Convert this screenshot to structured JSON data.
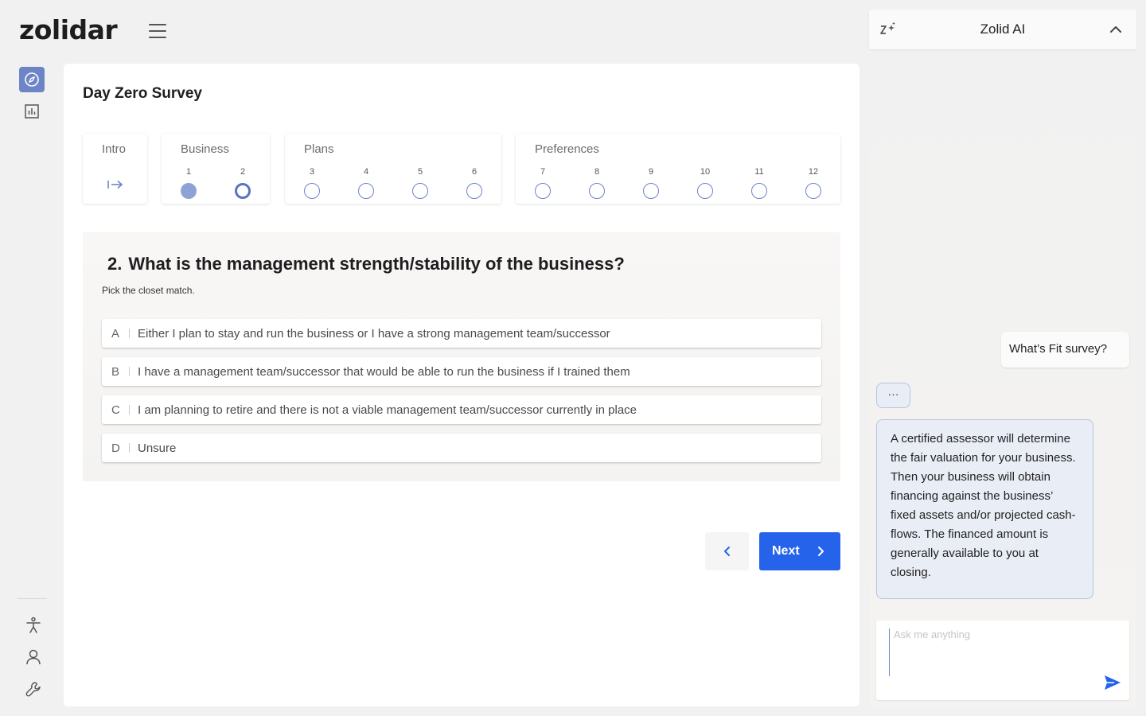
{
  "app": {
    "logo": "zolidar"
  },
  "survey": {
    "title": "Day Zero Survey",
    "steps": [
      {
        "label": "Intro"
      },
      {
        "label": "Business",
        "items": [
          "1",
          "2"
        ]
      },
      {
        "label": "Plans",
        "items": [
          "3",
          "4",
          "5",
          "6"
        ]
      },
      {
        "label": "Preferences",
        "items": [
          "7",
          "8",
          "9",
          "10",
          "11",
          "12"
        ]
      }
    ],
    "completed_questions": [
      "1"
    ],
    "current_question": "2",
    "question": {
      "number": "2.",
      "text": "What is the management strength/stability of the business?",
      "hint": "Pick the closet match.",
      "options": [
        {
          "letter": "A",
          "text": "Either I plan to stay and run the business or I have a strong management team/successor"
        },
        {
          "letter": "B",
          "text": "I have a management team/successor that would be able to run the business if I trained them"
        },
        {
          "letter": "C",
          "text": "I am planning to retire and there is not a viable management team/successor currently in place"
        },
        {
          "letter": "D",
          "text": "Unsure"
        }
      ]
    },
    "nav": {
      "next_label": "Next"
    }
  },
  "chat": {
    "title": "Zolid AI",
    "messages": {
      "user": "What’s Fit survey?",
      "typing": "···",
      "ai": "A certified assessor will determine the fair valuation for your business. Then your business will obtain financing against the business’ fixed assets and/or projected cash-flows. The financed amount is generally available to you at closing."
    },
    "input_placeholder": "Ask me anything"
  },
  "colors": {
    "primary": "#2563eb",
    "accent": "#6d85c6"
  }
}
